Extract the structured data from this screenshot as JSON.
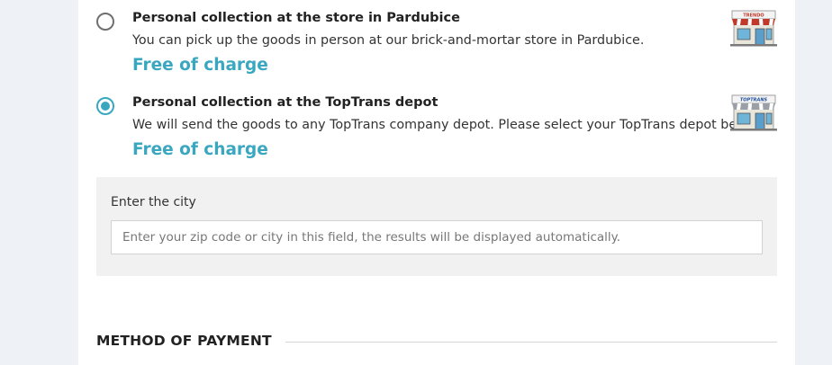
{
  "shipping_options": [
    {
      "title": "Personal collection at the store in Pardubice",
      "description": "You can pick up the goods in person at our brick-and-mortar store in Pardubice.",
      "price": "Free of charge",
      "selected": false,
      "icon": "store-icon",
      "sign_text": "TRENDO",
      "sign_color": "#c0392b"
    },
    {
      "title": "Personal collection at the TopTrans depot",
      "description": "We will send the goods to any TopTrans company depot. Please select your TopTrans depot below.",
      "price": "Free of charge",
      "selected": true,
      "icon": "store-icon",
      "sign_text": "TOPTRANS",
      "sign_color": "#1f4e9c"
    }
  ],
  "city_search": {
    "label": "Enter the city",
    "placeholder": "Enter your zip code or city in this field, the results will be displayed automatically.",
    "value": ""
  },
  "payment_section": {
    "title": "METHOD OF PAYMENT"
  },
  "colors": {
    "accent": "#3aa7c1",
    "page_background": "#eef2f6",
    "panel_background": "#f1f1f1"
  }
}
